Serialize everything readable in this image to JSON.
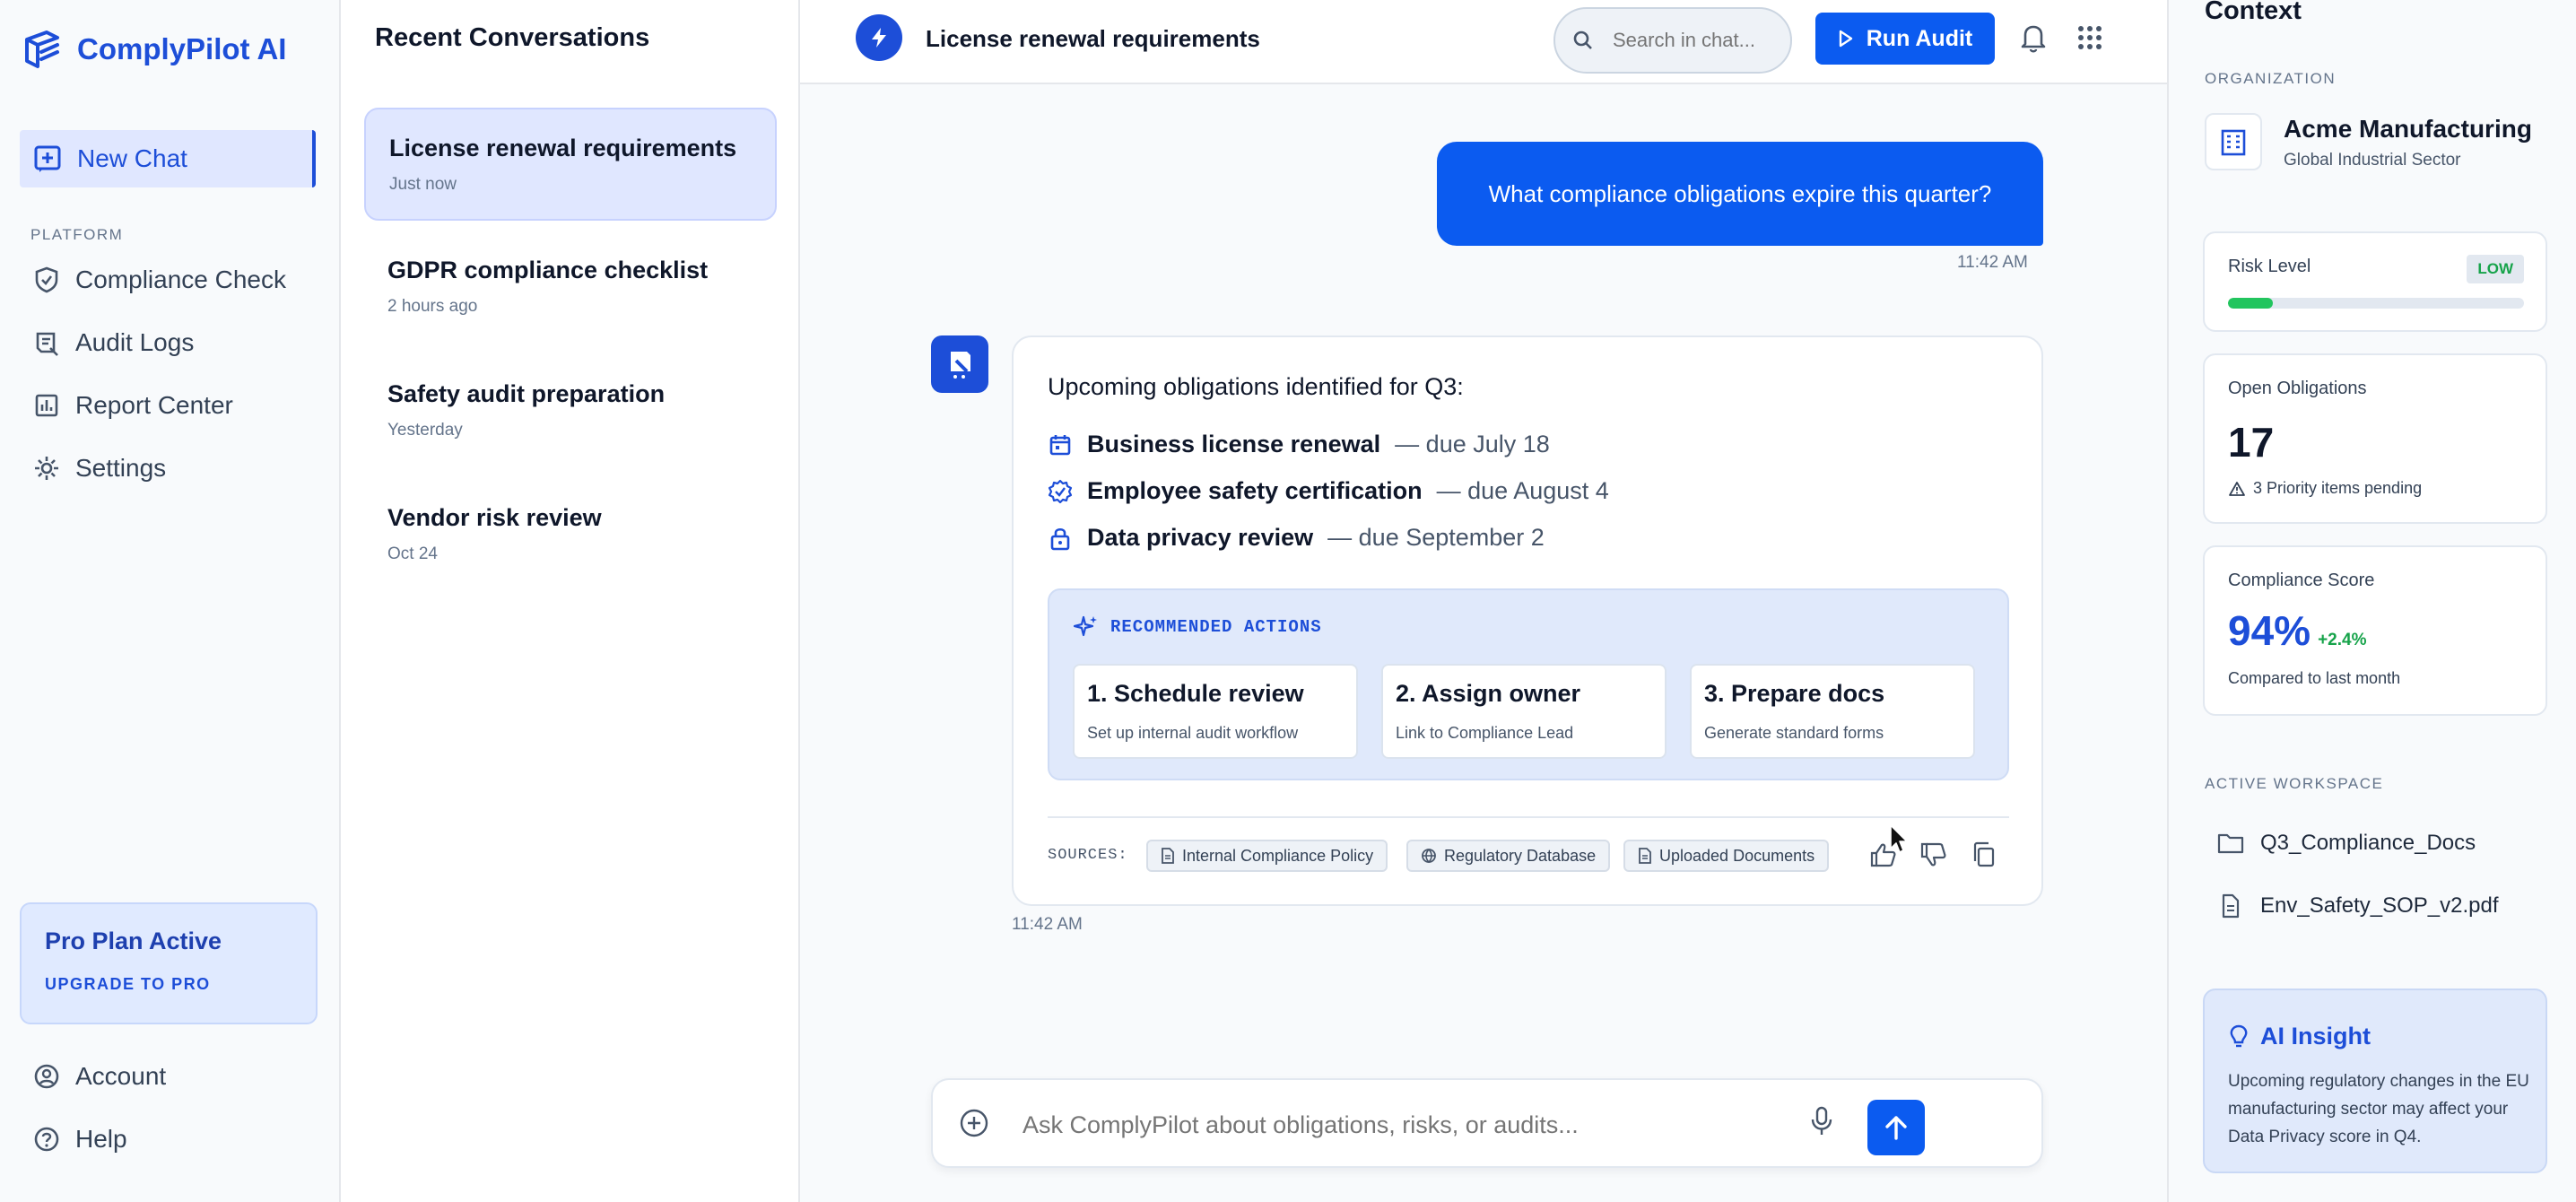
{
  "app": {
    "name": "ComplyPilot AI"
  },
  "colors": {
    "accent": "#0b5bf0",
    "brand": "#1d4ed8",
    "success": "#16a34a",
    "risk_fill": "#22c55e"
  },
  "sidebar": {
    "new_chat": "New Chat",
    "section_platform": "PLATFORM",
    "items": [
      {
        "label": "Compliance Check",
        "icon": "shield-check-icon"
      },
      {
        "label": "Audit Logs",
        "icon": "audit-log-icon"
      },
      {
        "label": "Report Center",
        "icon": "bar-chart-icon"
      },
      {
        "label": "Settings",
        "icon": "gear-icon"
      }
    ],
    "plan": {
      "title": "Pro Plan Active",
      "link": "UPGRADE TO PRO"
    },
    "account": "Account",
    "help": "Help"
  },
  "conversations": {
    "title": "Recent Conversations",
    "items": [
      {
        "title": "License renewal requirements",
        "time": "Just now"
      },
      {
        "title": "GDPR compliance checklist",
        "time": "2 hours ago"
      },
      {
        "title": "Safety audit preparation",
        "time": "Yesterday"
      },
      {
        "title": "Vendor risk review",
        "time": "Oct 24"
      }
    ]
  },
  "header": {
    "title": "License renewal requirements",
    "search_placeholder": "Search in chat...",
    "run_audit": "Run Audit"
  },
  "chat": {
    "user_message": "What compliance obligations expire this quarter?",
    "user_time": "11:42 AM",
    "bot": {
      "intro": "Upcoming obligations identified for Q3:",
      "obligations": [
        {
          "name": "Business license renewal",
          "due": "— due July 18",
          "icon": "calendar-icon"
        },
        {
          "name": "Employee safety certification",
          "due": "— due August 4",
          "icon": "badge-check-icon"
        },
        {
          "name": "Data privacy review",
          "due": "— due September 2",
          "icon": "lock-icon"
        }
      ],
      "recommended_title": "RECOMMENDED ACTIONS",
      "actions": [
        {
          "title": "1. Schedule review",
          "sub": "Set up internal audit workflow"
        },
        {
          "title": "2. Assign owner",
          "sub": "Link to Compliance Lead"
        },
        {
          "title": "3. Prepare docs",
          "sub": "Generate standard forms"
        }
      ],
      "sources_label": "SOURCES:",
      "sources": [
        "Internal Compliance Policy",
        "Regulatory Database",
        "Uploaded Documents"
      ],
      "time": "11:42 AM"
    },
    "composer_placeholder": "Ask ComplyPilot about obligations, risks, or audits..."
  },
  "context": {
    "title": "Context",
    "org_label": "ORGANIZATION",
    "org_name": "Acme Manufacturing",
    "org_sector": "Global Industrial Sector",
    "risk": {
      "label": "Risk Level",
      "badge": "LOW",
      "level_fraction": 0.15
    },
    "open_obligations": {
      "label": "Open Obligations",
      "value": "17",
      "note": "3 Priority items pending"
    },
    "compliance_score": {
      "label": "Compliance Score",
      "value": "94%",
      "delta": "+2.4%",
      "note": "Compared to last month"
    },
    "workspace_label": "ACTIVE WORKSPACE",
    "workspace": [
      {
        "name": "Q3_Compliance_Docs",
        "icon": "folder-icon"
      },
      {
        "name": "Env_Safety_SOP_v2.pdf",
        "icon": "file-icon"
      }
    ],
    "insight": {
      "title": "AI Insight",
      "body": "Upcoming regulatory changes in the EU manufacturing sector may affect your Data Privacy score in Q4."
    }
  }
}
